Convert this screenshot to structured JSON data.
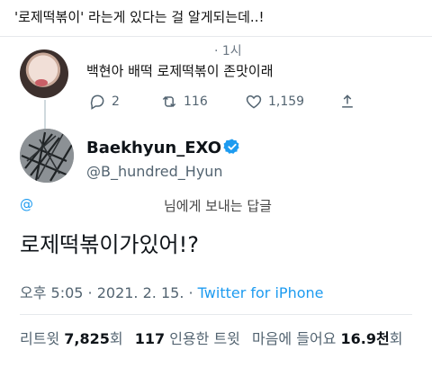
{
  "caption": "'로제떡볶이' 라는게 있다는 걸 알게되는데..!",
  "reply_context": {
    "time": "· 1시",
    "text": "백현아 배떡 로제떡볶이 존맛이래",
    "actions": {
      "replies": "2",
      "retweets": "116",
      "likes": "1,159"
    }
  },
  "main_tweet": {
    "display_name": "Baekhyun_EXO",
    "handle": "@B_hundred_Hyun",
    "reply_to_at": "@",
    "reply_to_text": "님에게 보내는 답글",
    "text": "로제떡볶이가있어!?",
    "time_date": "오후 5:05 · 2021. 2. 15. · ",
    "source": "Twitter for iPhone",
    "stats": {
      "retweets_label": "리트윗",
      "retweets_value": "7,825",
      "retweets_unit": "회",
      "quotes_value": "117",
      "quotes_label": "인용한 트윗",
      "likes_label": "마음에 들어요",
      "likes_value": "16.9천",
      "likes_unit": "회"
    }
  },
  "colors": {
    "accent": "#1d9bf0",
    "muted": "#536471"
  },
  "icons": {
    "reply": "reply-icon",
    "retweet": "retweet-icon",
    "like": "heart-icon",
    "share": "share-icon",
    "verified": "verified-badge-icon"
  }
}
